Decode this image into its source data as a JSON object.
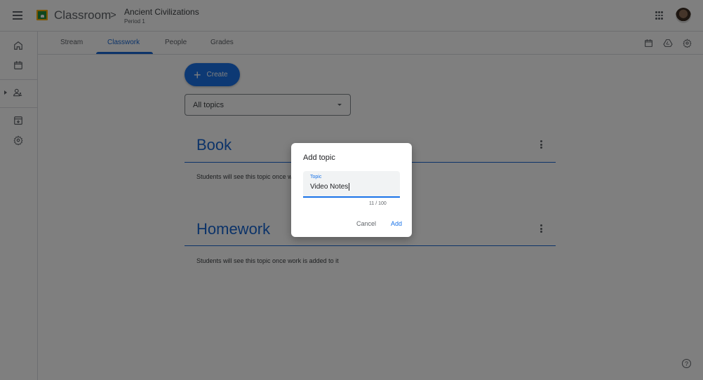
{
  "header": {
    "app_title": "Classroom",
    "breadcrumb_separator": ">",
    "class_name": "Ancient Civilizations",
    "class_section": "Period 1",
    "menu_icon": "menu-icon",
    "apps_icon": "apps-grid-icon",
    "avatar_icon": "account-avatar"
  },
  "rail": {
    "items": [
      {
        "name": "home",
        "icon": "home-icon"
      },
      {
        "name": "calendar",
        "icon": "calendar-icon"
      },
      {
        "name": "enrolled",
        "icon": "people-icon"
      },
      {
        "name": "archived",
        "icon": "archive-icon"
      },
      {
        "name": "settings",
        "icon": "settings-icon"
      }
    ]
  },
  "tabs": [
    {
      "label": "Stream",
      "active": false
    },
    {
      "label": "Classwork",
      "active": true
    },
    {
      "label": "People",
      "active": false
    },
    {
      "label": "Grades",
      "active": false
    }
  ],
  "toolbar_icons": [
    "calendar-icon",
    "drive-icon",
    "settings-icon"
  ],
  "classwork": {
    "create_label": "Create",
    "topic_filter": "All topics",
    "topics": [
      {
        "title": "Book",
        "note": "Students will see this topic once work is added to it"
      },
      {
        "title": "Homework",
        "note": "Students will see this topic once work is added to it"
      }
    ]
  },
  "dialog": {
    "title": "Add topic",
    "field_label": "Topic",
    "field_value": "Video Notes",
    "counter": "11 / 100",
    "cancel_label": "Cancel",
    "add_label": "Add"
  },
  "help_icon": "?",
  "colors": {
    "accent": "#1a73e8",
    "topic_blue": "#1967d2",
    "scrim": "rgba(0,0,0,0.5)"
  }
}
